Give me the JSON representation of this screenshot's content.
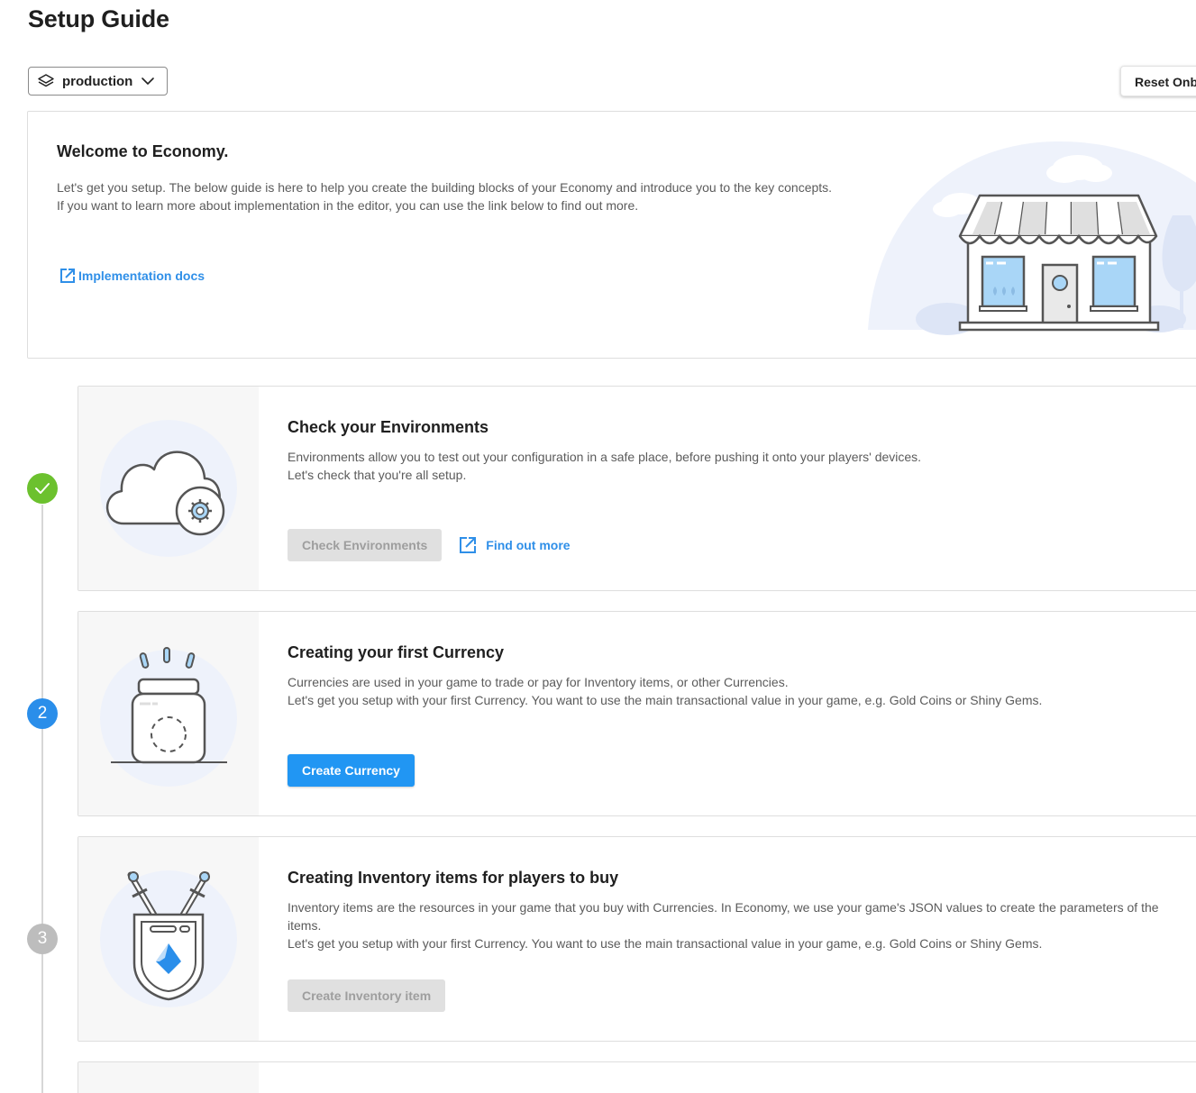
{
  "page": {
    "title": "Setup Guide"
  },
  "environment": {
    "selected": "production",
    "icon": "layers-icon"
  },
  "toolbar": {
    "reset_label": "Reset Onboarding"
  },
  "welcome": {
    "title": "Welcome to Economy.",
    "description": "Let's get you setup. The below guide is here to help you create the building blocks of your Economy and introduce you to the key concepts. If you want to learn more about implementation in the editor, you can use the link below to find out more.",
    "docs_link": "Implementation docs"
  },
  "steps": [
    {
      "status": "done",
      "marker": "",
      "title": "Check your Environments",
      "description_lines": [
        "Environments allow you to test out your configuration in a safe place, before pushing it onto your players' devices.",
        "Let's check that you're all setup."
      ],
      "button": "Check Environments",
      "button_state": "disabled",
      "link": "Find out more"
    },
    {
      "status": "active",
      "marker": "2",
      "title": "Creating your first Currency",
      "description_lines": [
        "Currencies are used in your game to trade or pay for Inventory items, or other Currencies.",
        "Let's get you setup with your first Currency. You want to use the main transactional value in your game, e.g. Gold Coins or Shiny Gems."
      ],
      "button": "Create Currency",
      "button_state": "enabled"
    },
    {
      "status": "pending",
      "marker": "3",
      "title": "Creating Inventory items for players to buy",
      "description_lines": [
        "Inventory items are the resources in your game that you buy with Currencies. In Economy, we use your game's JSON values to create the parameters of the items.",
        "Let's get you setup with your first Currency. You want to use the main transactional value in your game, e.g. Gold Coins or Shiny Gems."
      ],
      "button": "Create Inventory item",
      "button_state": "disabled"
    }
  ],
  "colors": {
    "accent": "#2196f3",
    "link": "#2f8fe8",
    "done": "#6cc12e",
    "pending": "#bdbdbd",
    "disabled_bg": "#e0e0e0"
  }
}
